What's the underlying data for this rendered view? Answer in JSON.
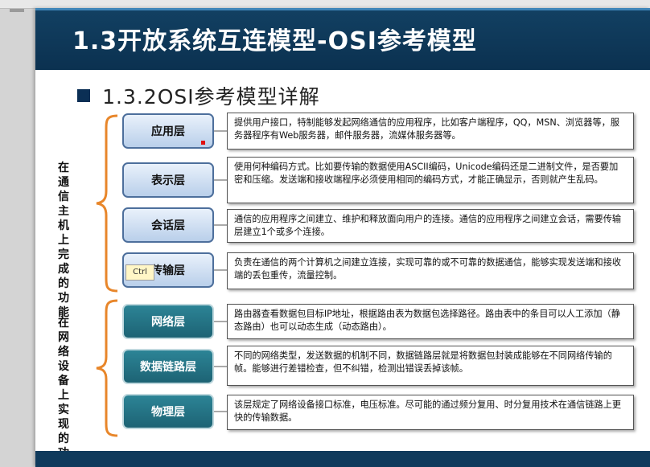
{
  "slide": {
    "title": "1.3开放系统互连模型-OSI参考模型",
    "subtitle": "1.3.2OSI参考模型详解"
  },
  "groups": {
    "host": "在通信主机上完成的功能",
    "network": "在网络设备上实现的功能"
  },
  "layers": [
    {
      "name": "应用层",
      "desc": "提供用户接口，特制能够发起网络通信的应用程序，比如客户端程序，QQ，MSN、浏览器等，服务器程序有Web服务器，邮件服务器，流媒体服务器等。"
    },
    {
      "name": "表示层",
      "desc": "使用何种编码方式。比如要传输的数据使用ASCII编码，Unicode编码还是二进制文件，是否要加密和压缩。发送端和接收端程序必须使用相同的编码方式，才能正确显示，否则就产生乱码。"
    },
    {
      "name": "会话层",
      "desc": "通信的应用程序之间建立、维护和释放面向用户的连接。通信的应用程序之间建立会话，需要传输层建立1个或多个连接。"
    },
    {
      "name": "传输层",
      "desc": "负责在通信的两个计算机之间建立连接，实现可靠的或不可靠的数据通信，能够实现发送端和接收端的丢包重传，流量控制。"
    },
    {
      "name": "网络层",
      "desc": "路由器查看数据包目标IP地址，根据路由表为数据包选择路径。路由表中的条目可以人工添加（静态路由）也可以动态生成（动态路由）。"
    },
    {
      "name": "数据链路层",
      "desc": "不同的网络类型，发送数据的机制不同，数据链路层就是将数据包封装成能够在不同网络传输的帧。能够进行差错检查，但不纠错，检测出错误丢掉该帧。"
    },
    {
      "name": "物理层",
      "desc": "该层规定了网络设备接口标准，电压标准。尽可能的通过频分复用、时分复用技术在通信链路上更快的传输数据。"
    }
  ],
  "tooltip": "Ctrl",
  "colors": {
    "title_bar": "#124062",
    "upper_layer_fill": "#c9dbf0",
    "lower_layer_fill": "#1f6d7e",
    "brace": "#e8862a",
    "marker": "#e01010"
  }
}
